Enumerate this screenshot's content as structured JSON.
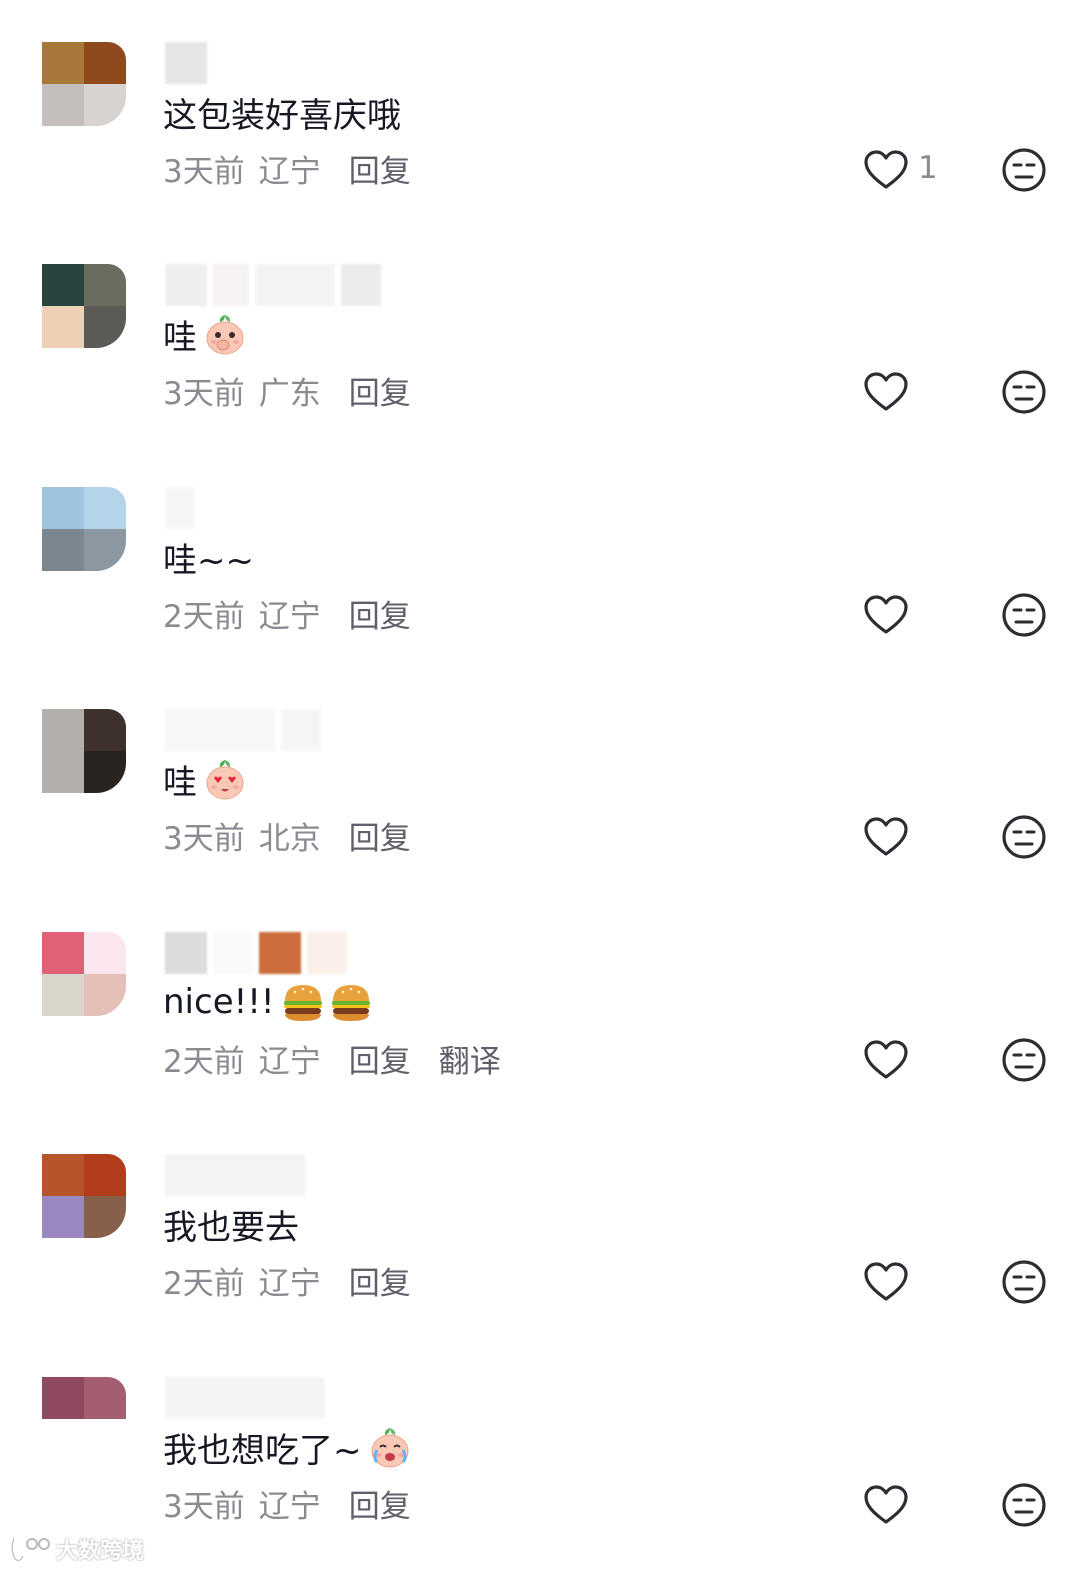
{
  "comments": [
    {
      "content": "这包装好喜庆哦",
      "time": "3天前",
      "location": "辽宁",
      "reply_label": "回复",
      "like_count": "1",
      "avatar_colors": [
        "#a8783a",
        "#8e4a1c",
        "#c4bfbc",
        "#d6d3d0"
      ],
      "emojis": []
    },
    {
      "content": "哇",
      "time": "3天前",
      "location": "广东",
      "reply_label": "回复",
      "like_count": "",
      "avatar_colors": [
        "#27443e",
        "#6c6b60",
        "#eed1b4",
        "#5b5a55"
      ],
      "emojis": [
        "peach-cover-face-emoji"
      ]
    },
    {
      "content": "哇~~",
      "time": "2天前",
      "location": "辽宁",
      "reply_label": "回复",
      "like_count": "",
      "avatar_colors": [
        "#9ec4e0",
        "#b4d4ea",
        "#7a8790",
        "#8b98a2"
      ],
      "emojis": []
    },
    {
      "content": "哇",
      "time": "3天前",
      "location": "北京",
      "reply_label": "回复",
      "like_count": "",
      "avatar_colors": [
        "#b3afac",
        "#3e302a",
        "#b3afac",
        "#2a2421"
      ],
      "emojis": [
        "peach-heart-eyes-emoji"
      ]
    },
    {
      "content": "nice!!!",
      "time": "2天前",
      "location": "辽宁",
      "reply_label": "回复",
      "translate_label": "翻译",
      "like_count": "",
      "avatar_colors": [
        "#e06078",
        "#fbe6f0",
        "#dad6cc",
        "#e4c0b8"
      ],
      "emojis": [
        "hamburger-emoji",
        "hamburger-emoji"
      ]
    },
    {
      "content": "我也要去",
      "time": "2天前",
      "location": "辽宁",
      "reply_label": "回复",
      "like_count": "",
      "avatar_colors": [
        "#b8542a",
        "#b23d1c",
        "#9a88c0",
        "#86604a"
      ],
      "emojis": []
    },
    {
      "content": "我也想吃了~",
      "time": "3天前",
      "location": "辽宁",
      "reply_label": "回复",
      "like_count": "",
      "avatar_colors": [
        "#8f4a60",
        "#a35e72",
        "#ffffff",
        "#ffffff"
      ],
      "emojis": [
        "peach-crying-emoji"
      ]
    }
  ],
  "watermark": {
    "text": "大数跨境"
  }
}
